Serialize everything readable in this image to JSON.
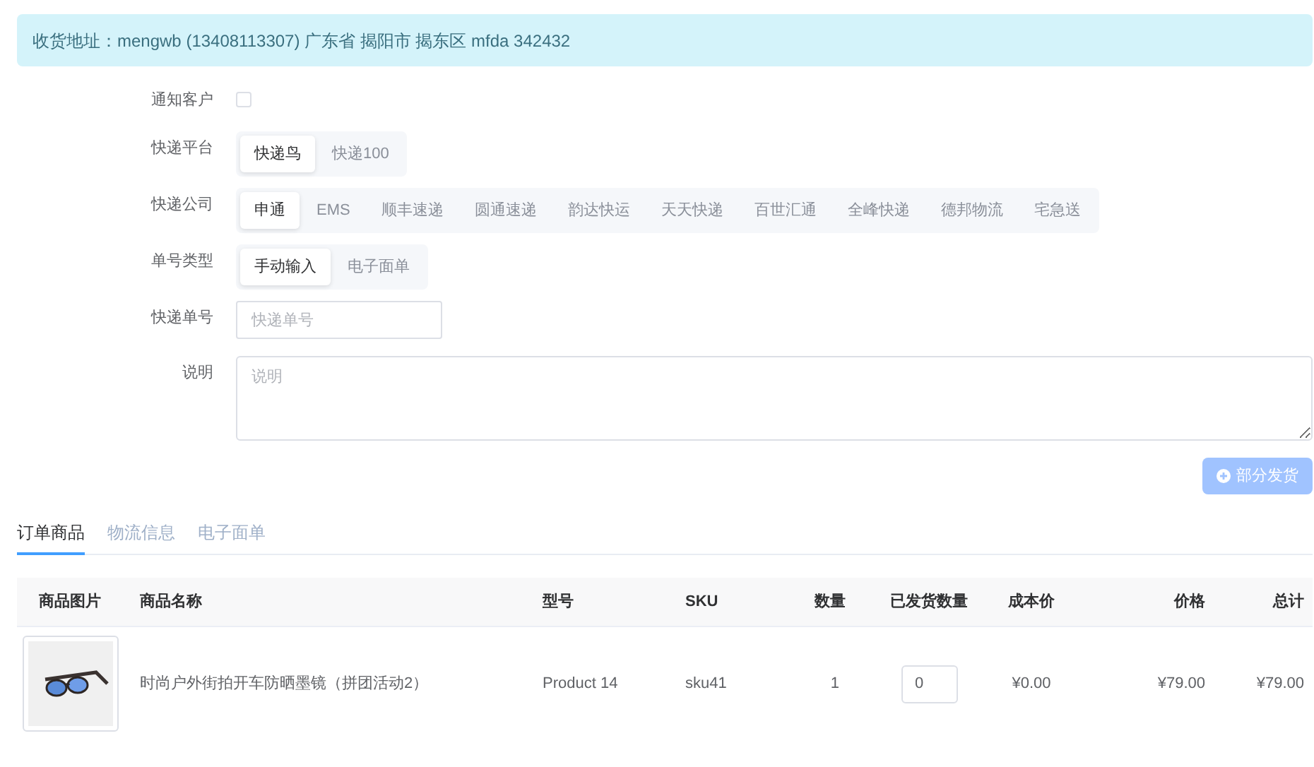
{
  "address_banner": {
    "text": "收货地址：mengwb (13408113307) 广东省 揭阳市 揭东区 mfda 342432"
  },
  "form": [
    {
      "kind": "checkbox",
      "label": "通知客户",
      "checked": false
    },
    {
      "kind": "segmented",
      "label": "快递平台",
      "options": [
        {
          "label": "快递鸟",
          "selected": true
        },
        {
          "label": "快递100",
          "selected": false
        }
      ]
    },
    {
      "kind": "segmented",
      "label": "快递公司",
      "options": [
        {
          "label": "申通",
          "selected": true
        },
        {
          "label": "EMS",
          "selected": false
        },
        {
          "label": "顺丰速递",
          "selected": false
        },
        {
          "label": "圆通速递",
          "selected": false
        },
        {
          "label": "韵达快运",
          "selected": false
        },
        {
          "label": "天天快递",
          "selected": false
        },
        {
          "label": "百世汇通",
          "selected": false
        },
        {
          "label": "全峰快递",
          "selected": false
        },
        {
          "label": "德邦物流",
          "selected": false
        },
        {
          "label": "宅急送",
          "selected": false
        }
      ]
    },
    {
      "kind": "segmented",
      "label": "单号类型",
      "options": [
        {
          "label": "手动输入",
          "selected": true
        },
        {
          "label": "电子面单",
          "selected": false
        }
      ]
    },
    {
      "kind": "input",
      "label": "快递单号",
      "placeholder": "快递单号"
    },
    {
      "kind": "textarea",
      "label": "说明",
      "placeholder": "说明"
    }
  ],
  "ship_button": {
    "label": "部分发货",
    "disabled": true
  },
  "tabs": [
    {
      "label": "订单商品",
      "selected": true
    },
    {
      "label": "物流信息",
      "selected": false
    },
    {
      "label": "电子面单",
      "selected": false
    }
  ],
  "table": {
    "columns": [
      "商品图片",
      "商品名称",
      "型号",
      "SKU",
      "数量",
      "已发货数量",
      "成本价",
      "价格",
      "总计"
    ],
    "rows": [
      {
        "name": "时尚户外街拍开车防晒墨镜（拼团活动2）",
        "model": "Product 14",
        "sku": "sku41",
        "quantity": "1",
        "shipped_quantity": "0",
        "cost_price": "¥0.00",
        "price": "¥79.00",
        "total": "¥79.00"
      }
    ]
  }
}
